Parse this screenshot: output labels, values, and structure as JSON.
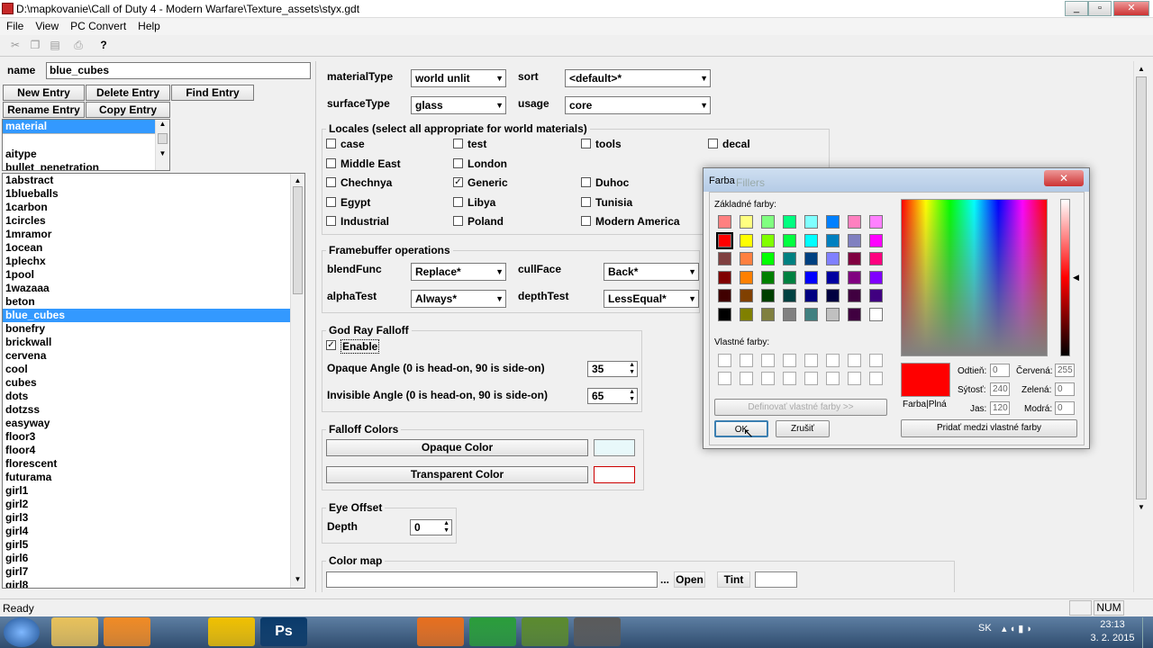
{
  "window": {
    "title": "D:\\mapkovanie\\Call of Duty 4 - Modern Warfare\\Texture_assets\\styx.gdt",
    "min": "_",
    "max": "▫",
    "close": "✕"
  },
  "menu": [
    "File",
    "View",
    "PC Convert",
    "Help"
  ],
  "left": {
    "name_label": "name",
    "name_value": "blue_cubes",
    "buttons": [
      "New Entry",
      "Delete Entry",
      "Find Entry",
      "Rename Entry",
      "Copy Entry"
    ],
    "type_list": [
      "material",
      "",
      "aitype",
      "bullet_penetration"
    ],
    "entries": [
      "1abstract",
      "1blueballs",
      "1carbon",
      "1circles",
      "1mramor",
      "1ocean",
      "1plechx",
      "1pool",
      "1wazaaa",
      "beton",
      "blue_cubes",
      "bonefry",
      "brickwall",
      "cervena",
      "cool",
      "cubes",
      "dots",
      "dotzss",
      "easyway",
      "floor3",
      "floor4",
      "florescent",
      "futurama",
      "girl1",
      "girl2",
      "girl3",
      "girl4",
      "girl5",
      "girl6",
      "girl7",
      "girl8"
    ]
  },
  "props": {
    "materialType_label": "materialType",
    "materialType": "world unlit",
    "sort_label": "sort",
    "sort": "<default>*",
    "surfaceType_label": "surfaceType",
    "surfaceType": "glass",
    "usage_label": "usage",
    "usage": "core",
    "locales_title": "Locales (select all appropriate for world materials)",
    "locales": [
      {
        "label": "case",
        "checked": false
      },
      {
        "label": "test",
        "checked": false
      },
      {
        "label": "tools",
        "checked": false
      },
      {
        "label": "decal",
        "checked": false
      },
      {
        "label": "Middle East",
        "checked": false
      },
      {
        "label": "London",
        "checked": false
      },
      {
        "label": "Chechnya",
        "checked": false
      },
      {
        "label": "Generic",
        "checked": true
      },
      {
        "label": "Duhoc",
        "checked": false
      },
      {
        "label": "Egypt",
        "checked": false
      },
      {
        "label": "Libya",
        "checked": false
      },
      {
        "label": "Tunisia",
        "checked": false
      },
      {
        "label": "Industrial",
        "checked": false
      },
      {
        "label": "Poland",
        "checked": false
      },
      {
        "label": "Modern America",
        "checked": false
      }
    ],
    "framebuffer_title": "Framebuffer operations",
    "blendFunc_label": "blendFunc",
    "blendFunc": "Replace*",
    "cullFace_label": "cullFace",
    "cullFace": "Back*",
    "alphaTest_label": "alphaTest",
    "alphaTest": "Always*",
    "depthTest_label": "depthTest",
    "depthTest": "LessEqual*",
    "godray_title": "God Ray Falloff",
    "enable_label": "Enable",
    "enable_checked": true,
    "opaque_angle_label": "Opaque Angle (0 is head-on, 90 is side-on)",
    "opaque_angle": "35",
    "invisible_angle_label": "Invisible Angle (0 is head-on, 90 is side-on)",
    "invisible_angle": "65",
    "falloff_title": "Falloff Colors",
    "opaque_color_btn": "Opaque Color",
    "transparent_color_btn": "Transparent Color",
    "opaque_color_swatch": "#e8f8fa",
    "transparent_color_swatch": "#ffffff",
    "eye_title": "Eye Offset",
    "depth_label": "Depth",
    "depth": "0",
    "colormap_title": "Color map",
    "colormap_value": "",
    "browse": "...",
    "open": "Open",
    "tint": "Tint"
  },
  "dialog": {
    "title": "Farba",
    "ghost_title": "Fillers",
    "close": "✕",
    "basic_label": "Základné farby:",
    "basic_colors": [
      "#ff8080",
      "#ffff80",
      "#80ff80",
      "#00ff80",
      "#80ffff",
      "#0080ff",
      "#ff80c0",
      "#ff80ff",
      "#ff0000",
      "#ffff00",
      "#80ff00",
      "#00ff40",
      "#00ffff",
      "#0080c0",
      "#8080c0",
      "#ff00ff",
      "#804040",
      "#ff8040",
      "#00ff00",
      "#008080",
      "#004080",
      "#8080ff",
      "#800040",
      "#ff0080",
      "#800000",
      "#ff8000",
      "#008000",
      "#008040",
      "#0000ff",
      "#0000a0",
      "#800080",
      "#8000ff",
      "#400000",
      "#804000",
      "#004000",
      "#004040",
      "#000080",
      "#000040",
      "#400040",
      "#400080",
      "#000000",
      "#808000",
      "#808040",
      "#808080",
      "#408080",
      "#c0c0c0",
      "#400040",
      "#ffffff"
    ],
    "selected_index": 8,
    "custom_label": "Vlastné farby:",
    "define_btn": "Definovať vlastné farby >>",
    "ok": "OK",
    "cancel": "Zrušiť",
    "add_btn": "Pridať medzi vlastné farby",
    "preview_label": "Farba|Plná",
    "preview_color": "#ff0000",
    "hue_label": "Odtieň:",
    "hue": "0",
    "sat_label": "Sýtosť:",
    "sat": "240",
    "lum_label": "Jas:",
    "lum": "120",
    "red_label": "Červená:",
    "red": "255",
    "green_label": "Zelená:",
    "green": "0",
    "blue_label": "Modrá:",
    "blue": "0"
  },
  "status": {
    "text": "Ready",
    "num": "NUM"
  },
  "taskbar": {
    "lang": "SK",
    "time": "23:13",
    "date": "3. 2. 2015",
    "apps": [
      "folder",
      "media",
      "atom",
      "norton",
      "photoshop",
      "opera",
      "terminal",
      "firefox",
      "chrome",
      "minecraft",
      "radiant",
      "asset",
      "effects"
    ],
    "ps": "Ps"
  }
}
